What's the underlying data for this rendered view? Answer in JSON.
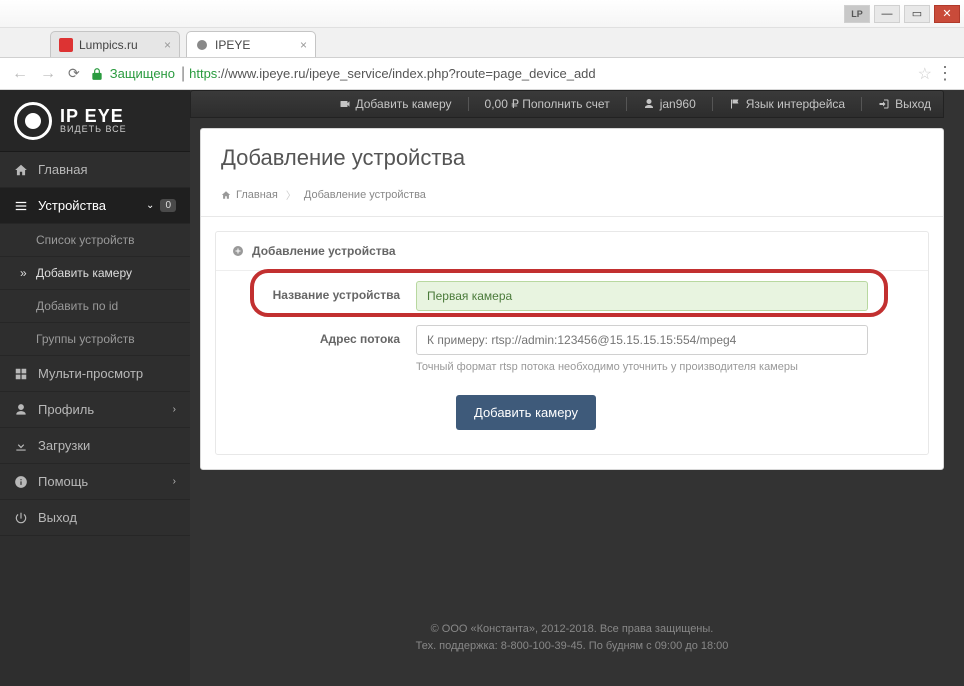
{
  "window": {
    "lp": "LP"
  },
  "tabs": [
    {
      "title": "Lumpics.ru"
    },
    {
      "title": "IPEYE"
    }
  ],
  "addressbar": {
    "secure_label": "Защищено",
    "https": "https",
    "url_rest": "://www.ipeye.ru/ipeye_service/index.php?route=page_device_add"
  },
  "header": {
    "add_camera": "Добавить камеру",
    "balance": "0,00 ₽ Пополнить счет",
    "user": "jan960",
    "lang": "Язык интерфейса",
    "logout": "Выход"
  },
  "logo": {
    "big": "IP EYE",
    "small": "ВИДЕТЬ ВСЕ"
  },
  "sidebar": {
    "home": "Главная",
    "devices": "Устройства",
    "devices_badge": "0",
    "device_list": "Список устройств",
    "add_camera": "Добавить камеру",
    "add_by_id": "Добавить по id",
    "device_groups": "Группы устройств",
    "multiview": "Мульти-просмотр",
    "profile": "Профиль",
    "downloads": "Загрузки",
    "help": "Помощь",
    "logout": "Выход"
  },
  "page": {
    "title": "Добавление устройства",
    "bc_home": "Главная",
    "bc_current": "Добавление устройства",
    "form_title": "Добавление устройства",
    "name_label": "Название устройства",
    "name_value": "Первая камера",
    "stream_label": "Адрес потока",
    "stream_placeholder": "К примеру: rtsp://admin:123456@15.15.15.15:554/mpeg4",
    "stream_hint": "Точный формат rtsp потока необходимо уточнить у производителя камеры",
    "submit": "Добавить камеру"
  },
  "footer": {
    "line1": "© ООО «Константа», 2012-2018. Все права защищены.",
    "line2": "Тех. поддержка: 8-800-100-39-45. По будням с 09:00 до 18:00"
  }
}
